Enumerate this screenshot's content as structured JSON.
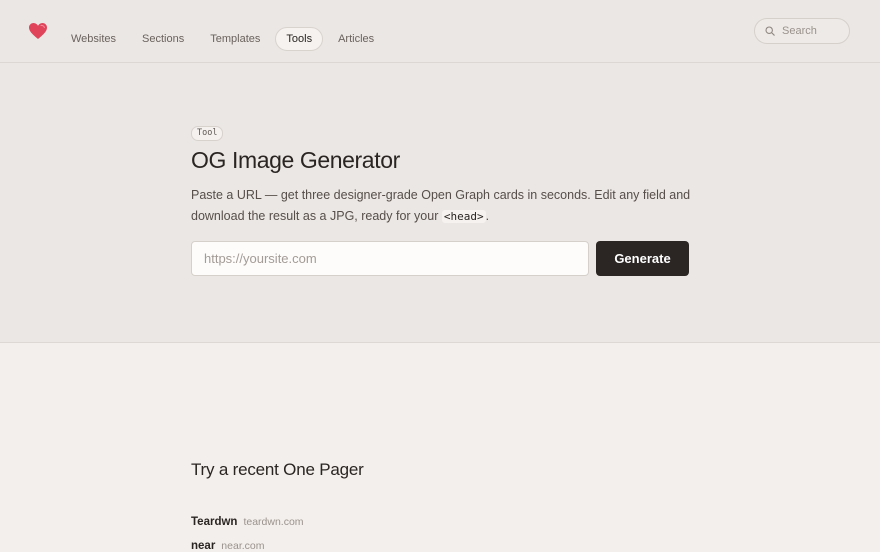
{
  "nav": {
    "links": [
      "Websites",
      "Sections",
      "Templates",
      "Tools",
      "Articles"
    ],
    "active": "Tools",
    "search_placeholder": "Search"
  },
  "hero": {
    "tag": "Tool",
    "title": "OG Image Generator",
    "desc_before": "Paste a URL — get three designer-grade Open Graph cards in seconds. Edit any field and download the result as a JPG, ready for your ",
    "desc_code": "<head>",
    "desc_after": ".",
    "url_placeholder": "https://yoursite.com",
    "generate_label": "Generate"
  },
  "recent": {
    "heading": "Try a recent One Pager",
    "items": [
      {
        "name": "Teardwn",
        "domain": "teardwn.com"
      },
      {
        "name": "near",
        "domain": "near.com"
      }
    ]
  },
  "colors": {
    "accent_heart": "#e0445a",
    "button_bg": "#2b2623",
    "hero_bg": "#ebe7e4",
    "page_bg": "#f3efec"
  }
}
